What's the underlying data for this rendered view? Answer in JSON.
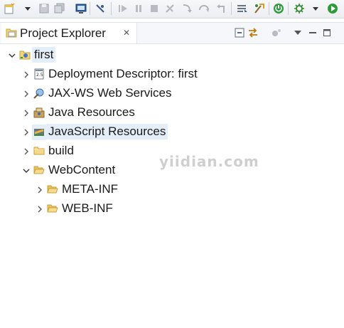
{
  "toolbar": {
    "icons": [
      "new-icon",
      "save-icon",
      "save-all-icon",
      "terminal-icon",
      "toggle-breakpoint-icon",
      "resume-icon",
      "suspend-icon",
      "terminate-icon",
      "disconnect-icon",
      "step-into-icon",
      "step-over-icon",
      "step-return-icon",
      "drop-to-frame-icon",
      "use-step-filters-icon",
      "server-icon",
      "run-last-icon",
      "run-icon"
    ]
  },
  "view": {
    "title": "Project Explorer",
    "close_glyph": "✕"
  },
  "tree": [
    {
      "label": "first",
      "icon": "project-icon",
      "expanded": true,
      "selected": true
    },
    {
      "label": "Deployment Descriptor: first",
      "icon": "deployment-descriptor-icon",
      "expanded": false
    },
    {
      "label": "JAX-WS Web Services",
      "icon": "web-services-icon",
      "expanded": false
    },
    {
      "label": "Java Resources",
      "icon": "java-resources-icon",
      "expanded": false
    },
    {
      "label": "JavaScript Resources",
      "icon": "javascript-resources-icon",
      "expanded": false,
      "highlighted": true
    },
    {
      "label": "build",
      "icon": "folder-icon",
      "expanded": false
    },
    {
      "label": "WebContent",
      "icon": "folder-open-icon",
      "expanded": true
    },
    {
      "label": "META-INF",
      "icon": "folder-icon",
      "expanded": false
    },
    {
      "label": "WEB-INF",
      "icon": "folder-icon",
      "expanded": false
    }
  ],
  "watermark": "yiidian.com"
}
